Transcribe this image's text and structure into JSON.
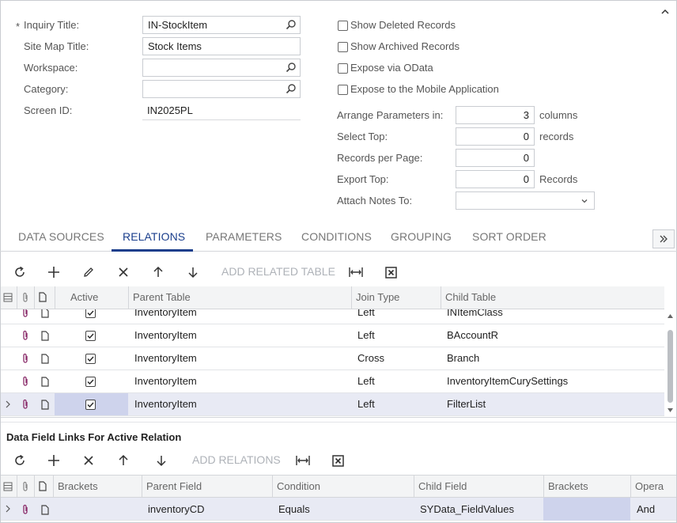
{
  "form": {
    "required_mark": "*",
    "inquiry_title_label": "Inquiry Title:",
    "inquiry_title_value": "IN-StockItem",
    "site_map_title_label": "Site Map Title:",
    "site_map_title_value": "Stock Items",
    "workspace_label": "Workspace:",
    "workspace_value": "",
    "category_label": "Category:",
    "category_value": "",
    "screen_id_label": "Screen ID:",
    "screen_id_value": "IN2025PL"
  },
  "options": {
    "show_deleted": {
      "label": "Show Deleted Records",
      "checked": false
    },
    "show_archived": {
      "label": "Show Archived Records",
      "checked": false
    },
    "expose_odata": {
      "label": "Expose via OData",
      "checked": false
    },
    "expose_mobile": {
      "label": "Expose to the Mobile Application",
      "checked": false
    },
    "arrange_label": "Arrange Parameters in:",
    "arrange_value": "3",
    "arrange_unit": "columns",
    "select_top_label": "Select Top:",
    "select_top_value": "0",
    "select_top_unit": "records",
    "records_per_page_label": "Records per Page:",
    "records_per_page_value": "0",
    "export_top_label": "Export Top:",
    "export_top_value": "0",
    "export_top_unit": "Records",
    "attach_notes_label": "Attach Notes To:",
    "attach_notes_value": ""
  },
  "tabs": [
    "DATA SOURCES",
    "RELATIONS",
    "PARAMETERS",
    "CONDITIONS",
    "GROUPING",
    "SORT ORDER"
  ],
  "active_tab": "RELATIONS",
  "relations_toolbar": {
    "add_related_table": "ADD RELATED TABLE"
  },
  "relations_grid": {
    "columns": [
      "Active",
      "Parent Table",
      "Join Type",
      "Child Table"
    ],
    "rows": [
      {
        "active": true,
        "parent": "InventoryItem",
        "join": "Left",
        "child": "INItemClass"
      },
      {
        "active": true,
        "parent": "InventoryItem",
        "join": "Left",
        "child": "BAccountR"
      },
      {
        "active": true,
        "parent": "InventoryItem",
        "join": "Cross",
        "child": "Branch"
      },
      {
        "active": true,
        "parent": "InventoryItem",
        "join": "Left",
        "child": "InventoryItemCurySettings"
      },
      {
        "active": true,
        "parent": "InventoryItem",
        "join": "Left",
        "child": "FilterList"
      }
    ]
  },
  "links_section": {
    "title": "Data Field Links For Active Relation",
    "add_relations": "ADD RELATIONS",
    "columns": [
      "Brackets",
      "Parent Field",
      "Condition",
      "Child Field",
      "Brackets",
      "Opera"
    ],
    "rows": [
      {
        "brackets": "",
        "parent_field": "inventoryCD",
        "condition": "Equals",
        "child_field": "SYData_FieldValues",
        "brackets2": "",
        "operator": "And"
      }
    ]
  },
  "colors": {
    "accent": "#1a3e8c",
    "selected_row": "#e8eaf4",
    "selected_cell": "#ced3ec",
    "attach_icon": "#8a2c6a"
  }
}
